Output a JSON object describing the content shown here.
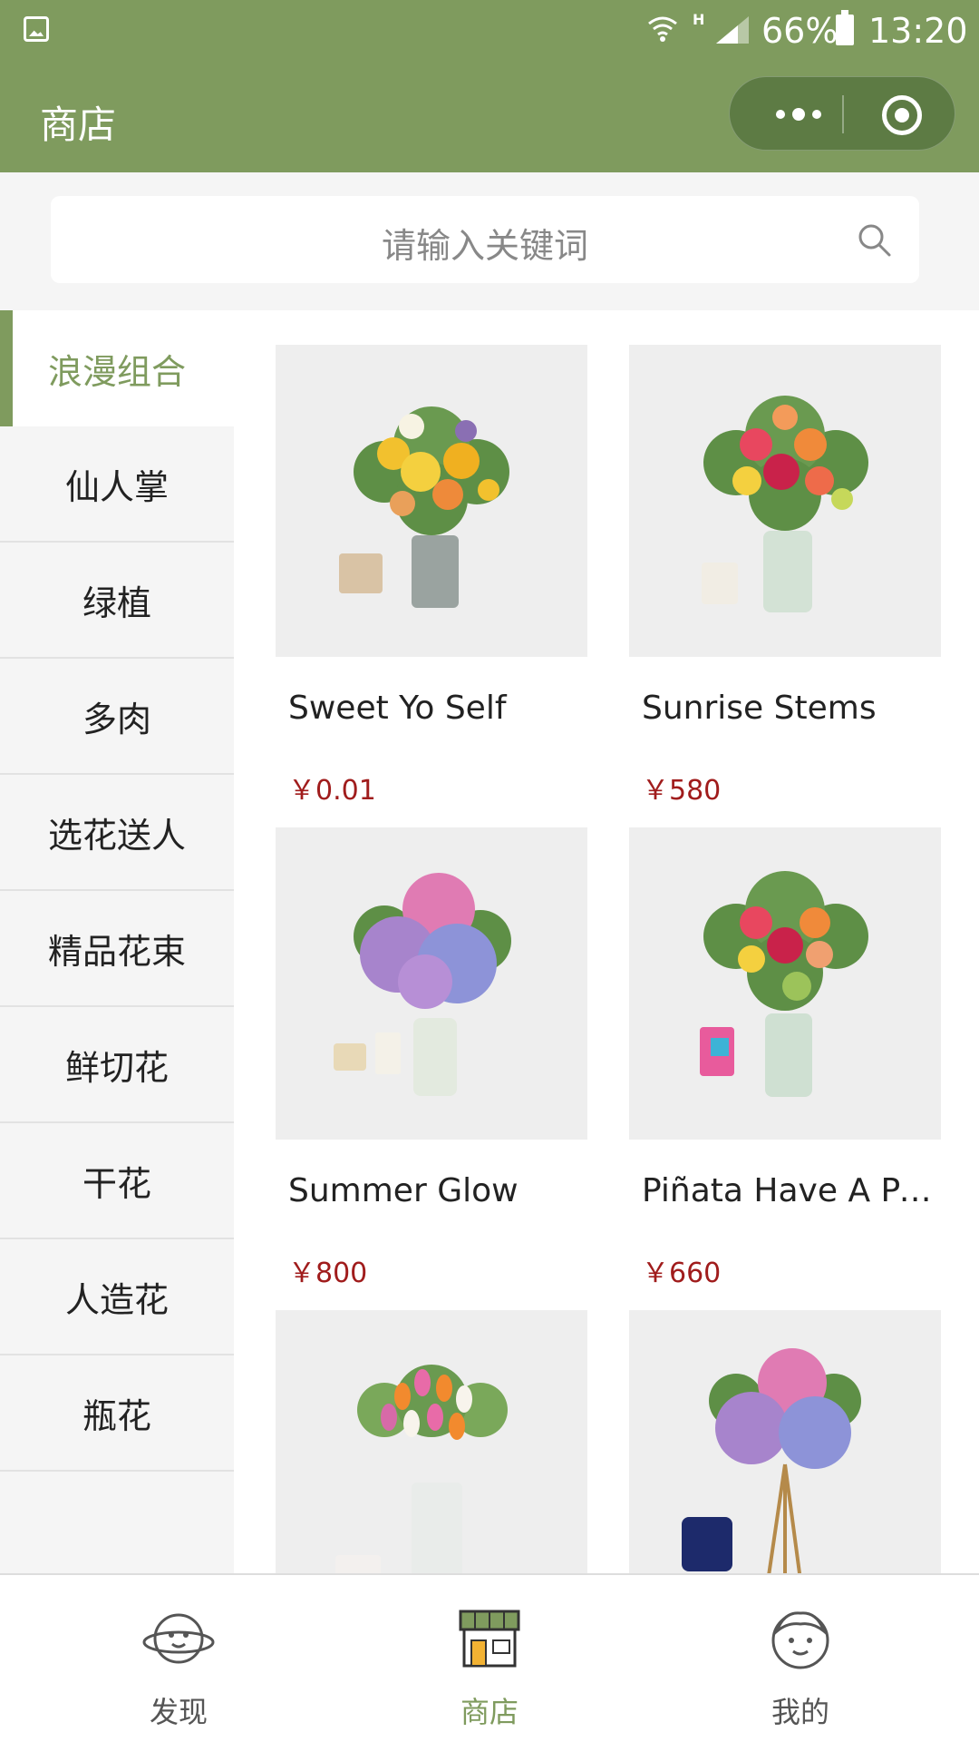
{
  "status_bar": {
    "signal_mark": "H",
    "battery": "66%",
    "time": "13:20"
  },
  "nav": {
    "title": "商店"
  },
  "search": {
    "placeholder": "请输入关键词"
  },
  "categories": [
    {
      "label": "浪漫组合",
      "active": true
    },
    {
      "label": "仙人掌",
      "active": false
    },
    {
      "label": "绿植",
      "active": false
    },
    {
      "label": "多肉",
      "active": false
    },
    {
      "label": "选花送人",
      "active": false
    },
    {
      "label": "精品花束",
      "active": false
    },
    {
      "label": "鲜切花",
      "active": false
    },
    {
      "label": "干花",
      "active": false
    },
    {
      "label": "人造花",
      "active": false
    },
    {
      "label": "瓶花",
      "active": false
    }
  ],
  "products": [
    {
      "name": "Sweet Yo Self",
      "price": "￥0.01"
    },
    {
      "name": "Sunrise Stems",
      "price": "￥580"
    },
    {
      "name": "Summer Glow",
      "price": "￥800"
    },
    {
      "name": "Piñata Have A Pa…",
      "price": "￥660"
    },
    {
      "name": "",
      "price": ""
    },
    {
      "name": "",
      "price": ""
    }
  ],
  "tabs": [
    {
      "label": "发现",
      "icon": "planet-face-icon",
      "active": false
    },
    {
      "label": "商店",
      "icon": "storefront-icon",
      "active": true
    },
    {
      "label": "我的",
      "icon": "person-face-icon",
      "active": false
    }
  ],
  "colors": {
    "brand": "#7f9b5e",
    "price": "#a01c1c"
  }
}
